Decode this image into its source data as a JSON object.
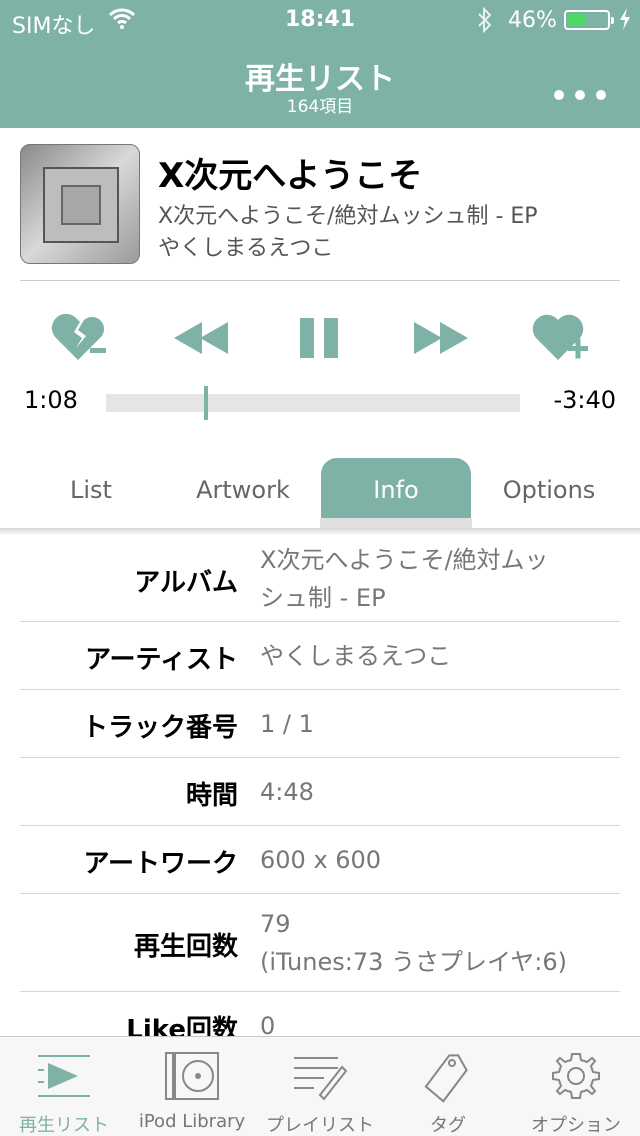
{
  "status": {
    "carrier": "SIMなし",
    "time": "18:41",
    "battery_pct": "46%",
    "battery_level": 0.46,
    "battery_color": "#4cd964"
  },
  "navbar": {
    "title": "再生リスト",
    "subtitle": "164項目",
    "bg_color": "#7fb2a6"
  },
  "now_playing": {
    "title": "X次元へようこそ",
    "album": "X次元へようこそ/絶対ムッシュ制 - EP",
    "artist": "やくしまるえつこ",
    "elapsed": "1:08",
    "remaining": "-3:40",
    "progress": 0.236
  },
  "controls": {
    "dislike": "heart-broken-minus-icon",
    "prev": "rewind-icon",
    "pause": "pause-icon",
    "next": "fast-forward-icon",
    "like": "heart-plus-icon"
  },
  "tabs": [
    "List",
    "Artwork",
    "Info",
    "Options"
  ],
  "active_tab": "Info",
  "info_rows": [
    {
      "label": "アルバム",
      "value_lines": [
        "X次元へようこそ/絶対ムッ",
        "シュ制 - EP"
      ]
    },
    {
      "label": "アーティスト",
      "value_lines": [
        "やくしまるえつこ"
      ]
    },
    {
      "label": "トラック番号",
      "value_lines": [
        "1 / 1"
      ]
    },
    {
      "label": "時間",
      "value_lines": [
        "4:48"
      ]
    },
    {
      "label": "アートワーク",
      "value_lines": [
        "600 x 600"
      ]
    },
    {
      "label": "再生回数",
      "value_lines": [
        "79",
        "(iTunes:73 うさプレイヤ:6)"
      ]
    },
    {
      "label": "Like回数",
      "value_lines": [
        "0"
      ]
    }
  ],
  "tabbar": [
    {
      "label": "再生リスト",
      "icon": "playlist-play-icon",
      "active": true
    },
    {
      "label": "iPod Library",
      "icon": "ipod-library-icon",
      "active": false
    },
    {
      "label": "プレイリスト",
      "icon": "playlist-edit-icon",
      "active": false
    },
    {
      "label": "タグ",
      "icon": "tag-icon",
      "active": false
    },
    {
      "label": "オプション",
      "icon": "gear-icon",
      "active": false
    }
  ]
}
